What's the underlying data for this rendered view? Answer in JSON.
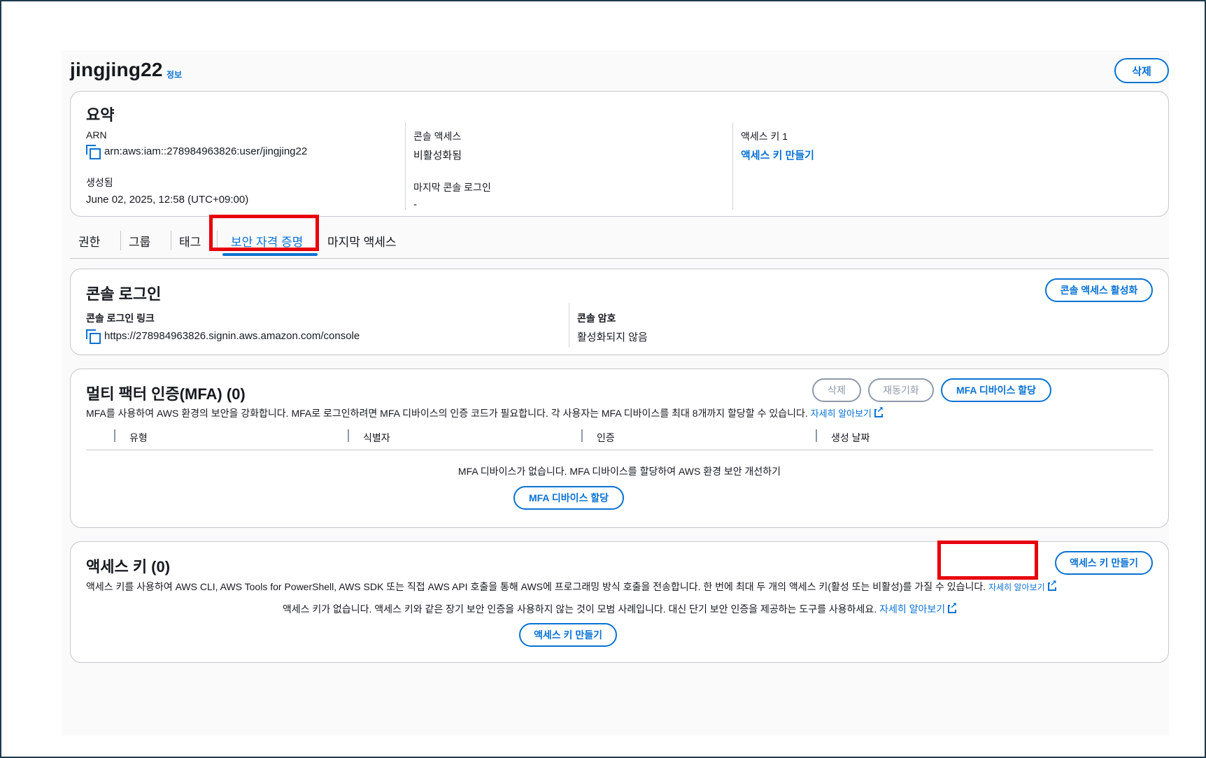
{
  "header": {
    "username": "jingjing22",
    "info_link": "정보",
    "delete_button": "삭제"
  },
  "summary": {
    "title": "요약",
    "arn_label": "ARN",
    "arn_value": "arn:aws:iam::278984963826:user/jingjing22",
    "created_label": "생성됨",
    "created_value": "June 02, 2025, 12:58 (UTC+09:00)",
    "console_access_label": "콘솔 액세스",
    "console_access_value": "비활성화됨",
    "last_login_label": "마지막 콘솔 로그인",
    "last_login_value": "-",
    "access_key_label": "액세스 키 1",
    "access_key_link": "액세스 키 만들기"
  },
  "tabs": [
    {
      "label": "권한"
    },
    {
      "label": "그룹"
    },
    {
      "label": "태그"
    },
    {
      "label": "보안 자격 증명",
      "active": true
    },
    {
      "label": "마지막 액세스"
    }
  ],
  "console_login": {
    "title": "콘솔 로그인",
    "enable_button": "콘솔 액세스 활성화",
    "link_label": "콘솔 로그인 링크",
    "link_value": "https://278984963826.signin.aws.amazon.com/console",
    "password_label": "콘솔 암호",
    "password_value": "활성화되지 않음"
  },
  "mfa": {
    "title": "멀티 팩터 인증(MFA) (0)",
    "delete_button": "삭제",
    "resync_button": "재동기화",
    "assign_button": "MFA 디바이스 할당",
    "description": "MFA를 사용하여 AWS 환경의 보안을 강화합니다. MFA로 로그인하려면 MFA 디바이스의 인증 코드가 필요합니다. 각 사용자는 MFA 디바이스를 최대 8개까지 할당할 수 있습니다.",
    "learn_more": "자세히 알아보기",
    "columns": [
      "유형",
      "식별자",
      "인증",
      "생성 날짜"
    ],
    "empty_text": "MFA 디바이스가 없습니다. MFA 디바이스를 할당하여 AWS 환경 보안 개선하기",
    "empty_button": "MFA 디바이스 할당"
  },
  "access_keys": {
    "title": "액세스 키 (0)",
    "create_button": "액세스 키 만들기",
    "description": "액세스 키를 사용하여 AWS CLI, AWS Tools for PowerShell, AWS SDK 또는 직접 AWS API 호출을 통해 AWS에 프로그래밍 방식 호출을 전송합니다. 한 번에 최대 두 개의 액세스 키(활성 또는 비활성)를 가질 수 있습니다.",
    "learn_more": "자세히 알아보기",
    "empty_text": "액세스 키가 없습니다. 액세스 키와 같은 장기 보안 인증을 사용하지 않는 것이 모범 사례입니다. 대신 단기 보안 인증을 제공하는 도구를 사용하세요.",
    "empty_learn_more": "자세히 알아보기",
    "empty_button": "액세스 키 만들기"
  },
  "colors": {
    "accent": "#0972d3",
    "highlight": "#e8000b",
    "border": "#c6c6cd"
  }
}
